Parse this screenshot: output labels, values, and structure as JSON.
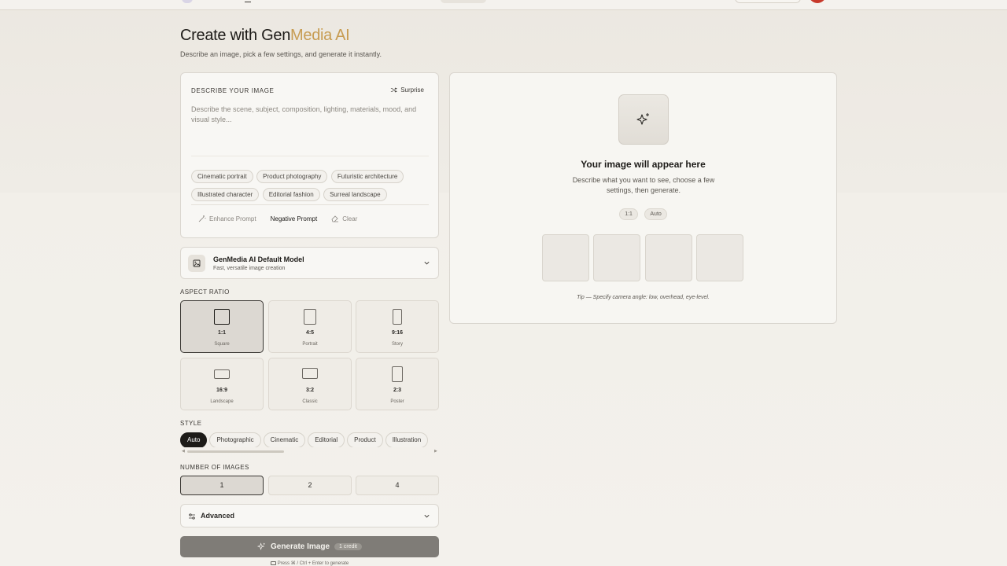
{
  "header": {
    "title_prefix": "Create with Gen",
    "title_accent": "Media AI",
    "subtitle": "Describe an image, pick a few settings, and generate it instantly."
  },
  "prompt": {
    "label": "DESCRIBE YOUR IMAGE",
    "surprise_label": "Surprise",
    "placeholder": "Describe the scene, subject, composition, lighting, materials, mood, and visual style...",
    "value": "",
    "suggestions": [
      "Cinematic portrait",
      "Product photography",
      "Futuristic architecture",
      "Illustrated character",
      "Editorial fashion",
      "Surreal landscape"
    ],
    "actions": {
      "enhance": "Enhance Prompt",
      "negative": "Negative Prompt",
      "clear": "Clear"
    }
  },
  "model": {
    "name": "GenMedia AI Default Model",
    "description": "Fast, versatile image creation"
  },
  "aspect_ratio": {
    "label": "ASPECT RATIO",
    "selected": "1:1",
    "options": [
      {
        "value": "1:1",
        "name": "Square"
      },
      {
        "value": "4:5",
        "name": "Portrait"
      },
      {
        "value": "9:16",
        "name": "Story"
      },
      {
        "value": "16:9",
        "name": "Landscape"
      },
      {
        "value": "3:2",
        "name": "Classic"
      },
      {
        "value": "2:3",
        "name": "Poster"
      }
    ]
  },
  "style": {
    "label": "STYLE",
    "selected": "Auto",
    "options": [
      "Auto",
      "Photographic",
      "Cinematic",
      "Editorial",
      "Product",
      "Illustration"
    ]
  },
  "num_images": {
    "label": "NUMBER OF IMAGES",
    "selected": "1",
    "options": [
      "1",
      "2",
      "4"
    ]
  },
  "advanced": {
    "label": "Advanced"
  },
  "generate": {
    "label": "Generate Image",
    "credit": "1 credit",
    "hint": "Press ⌘ / Ctrl + Enter to generate"
  },
  "preview": {
    "title": "Your image will appear here",
    "description": "Describe what you want to see, choose a few settings, then generate.",
    "tags": [
      "1:1",
      "Auto"
    ],
    "tip": "Tip — Specify camera angle: low, overhead, eye-level."
  },
  "colors": {
    "accent": "#c79c52",
    "background": "#f1eee8",
    "generate_button": "#7f7c77",
    "avatar": "#c7392b"
  },
  "icons": [
    "surprise-shuffle-icon",
    "magic-wand-icon",
    "eraser-icon",
    "image-icon",
    "chevron-down-icon",
    "sliders-icon",
    "sparkle-icon",
    "keyboard-icon"
  ]
}
